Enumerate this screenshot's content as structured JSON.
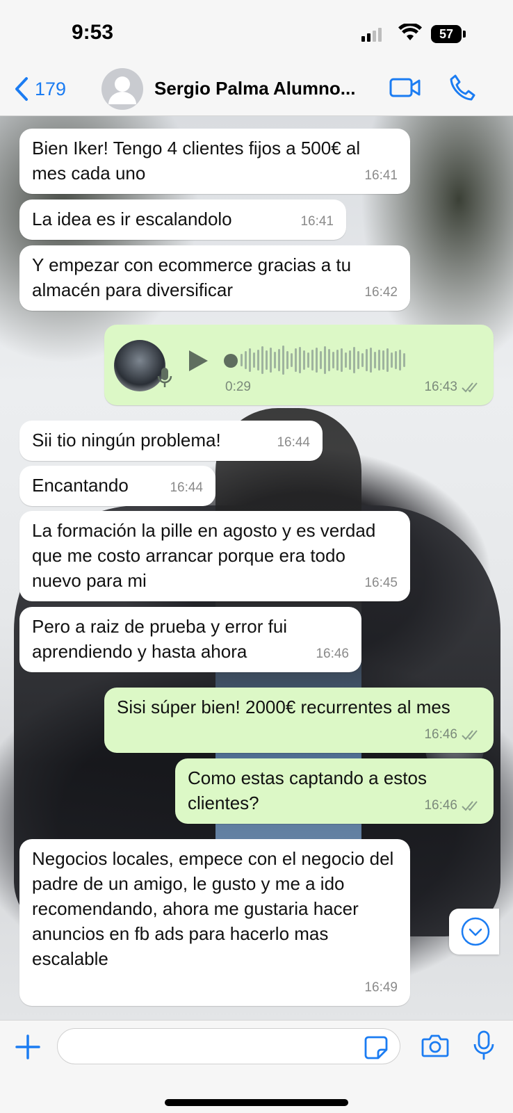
{
  "status_bar": {
    "time": "9:53",
    "battery": "57"
  },
  "header": {
    "back_count": "179",
    "contact_name": "Sergio Palma Alumno...",
    "icons": [
      "chevron-left-icon",
      "avatar",
      "video-call-icon",
      "phone-icon"
    ]
  },
  "messages": [
    {
      "dir": "in",
      "text": "Bien Iker! Tengo 4 clientes fijos a 500€ al mes cada uno",
      "time": "16:41"
    },
    {
      "dir": "in",
      "text": "La idea es ir escalandolo",
      "time": "16:41"
    },
    {
      "dir": "in",
      "text": "Y empezar con ecommerce gracias a tu almacén para diversificar",
      "time": "16:42"
    },
    {
      "dir": "out",
      "type": "voice",
      "duration": "0:29",
      "time": "16:43",
      "read": true
    },
    {
      "dir": "in",
      "text": "Sii tio ningún problema!",
      "time": "16:44"
    },
    {
      "dir": "in",
      "text": "Encantando",
      "time": "16:44"
    },
    {
      "dir": "in",
      "text": "La formación la pille en agosto y es verdad que me costo arrancar porque era todo nuevo para mi",
      "time": "16:45"
    },
    {
      "dir": "in",
      "text": "Pero a raiz de prueba y error fui aprendiendo y hasta ahora",
      "time": "16:46"
    },
    {
      "dir": "out",
      "text": "Sisi súper bien! 2000€ recurrentes al mes",
      "time": "16:46",
      "read": true
    },
    {
      "dir": "out",
      "text": "Como estas captando a estos clientes?",
      "time": "16:46",
      "read": true
    },
    {
      "dir": "in",
      "text": "Negocios locales, empece con el negocio del padre de un amigo, le gusto y me a ido recomendando, ahora me gustaria hacer anuncios en fb ads para hacerlo mas escalable",
      "time": "16:49"
    }
  ],
  "input": {
    "value": ""
  },
  "colors": {
    "accent": "#1b7cf2",
    "incoming": "#ffffff",
    "outgoing": "#dcf8c6"
  }
}
